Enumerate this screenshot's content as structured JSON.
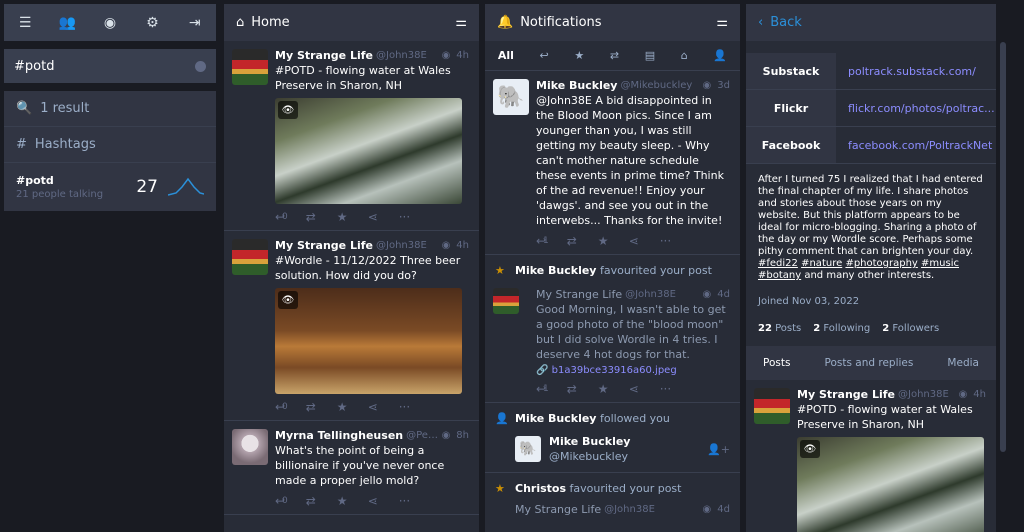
{
  "nav": {
    "icons": [
      "menu-icon",
      "people-icon",
      "globe-icon",
      "gear-icon",
      "logout-icon"
    ]
  },
  "search": {
    "value": "#potd"
  },
  "results": {
    "count_label": "1 result",
    "hashtags_label": "Hashtags",
    "hashtag": {
      "tag": "#potd",
      "talking": "21 people talking",
      "count": "27"
    }
  },
  "home": {
    "title": "Home",
    "statuses": [
      {
        "name": "My Strange Life",
        "acct": "@John38E",
        "time": "4h",
        "text": "#POTD - flowing water at Wales Preserve in Sharon, NH",
        "replies": "0"
      },
      {
        "name": "My Strange Life",
        "acct": "@John38E",
        "time": "4h",
        "text": "#Wordle - 11/12/2022 Three beer solution. How did you do?",
        "replies": "0"
      },
      {
        "name": "Myrna Tellingheusen",
        "acct": "@PearlsF...",
        "time": "8h",
        "text": "What's the point of being a billionaire if you've never once made a proper jello mold?",
        "replies": "0"
      }
    ]
  },
  "notifications": {
    "title": "Notifications",
    "filter_all": "All",
    "mention": {
      "name": "Mike Buckley",
      "acct": "@Mikebuckley",
      "time": "3d",
      "text": "@John38E  A bid disappointed in the Blood Moon pics.  Since I am younger than you, I was still getting my beauty sleep.  - Why can't mother nature schedule these events in prime time?  Think of the ad revenue!! Enjoy your 'dawgs'. and see you out in the interwebs... Thanks for the invite!",
      "replies": "1"
    },
    "fav1": {
      "name": "Mike Buckley",
      "action": "favourited your post"
    },
    "fav1_status": {
      "name": "My Strange Life",
      "acct": "@John38E",
      "time": "4d",
      "text": "Good Morning,  I wasn't able to get a good photo of the \"blood moon\" but I did solve Wordle in 4 tries. I deserve 4 hot dogs for that.",
      "attachment": "b1a39bce33916a60.jpeg",
      "replies": "1"
    },
    "follow": {
      "name": "Mike Buckley",
      "action": "followed you",
      "acct": "@Mikebuckley"
    },
    "fav2": {
      "name": "Christos",
      "action": "favourited your post"
    },
    "fav2_status": {
      "name": "My Strange Life",
      "acct": "@John38E",
      "time": "4d"
    }
  },
  "profile": {
    "back": "Back",
    "fields": [
      {
        "k": "Substack",
        "v": "poltrack.substack.com/"
      },
      {
        "k": "Flickr",
        "v": "flickr.com/photos/poltrac..."
      },
      {
        "k": "Facebook",
        "v": "facebook.com/PoltrackNet"
      }
    ],
    "bio": "After I turned 75 I realized that I had entered the final chapter of my life. I share photos and stories about those years on my website. But this platform appears to be ideal for micro-blogging. Sharing a photo of the day or my Wordle score. Perhaps some pithy comment that can brighten your day.",
    "bio_tags": [
      "#fedi22",
      "#nature",
      "#photography",
      "#music",
      "#botany"
    ],
    "bio_end": "and many other interests.",
    "joined": "Joined Nov 03, 2022",
    "posts": "22",
    "posts_label": "Posts",
    "following": "2",
    "following_label": "Following",
    "followers": "2",
    "followers_label": "Followers",
    "tabs": [
      "Posts",
      "Posts and replies",
      "Media"
    ],
    "status": {
      "name": "My Strange Life",
      "acct": "@John38E",
      "time": "4h",
      "text": "#POTD - flowing water at Wales Preserve in Sharon, NH"
    }
  }
}
